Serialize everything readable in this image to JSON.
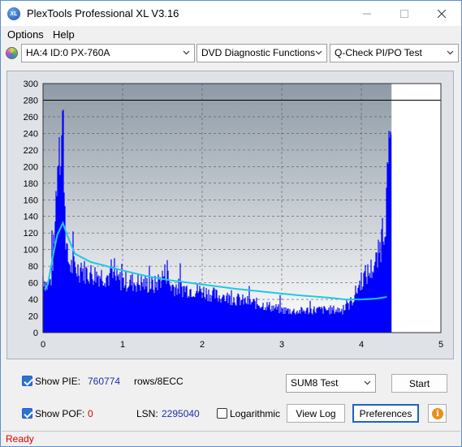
{
  "window": {
    "title": "PlexTools Professional XL V3.16",
    "app_icon_text": "XL"
  },
  "menu": {
    "options": "Options",
    "help": "Help"
  },
  "toolbar": {
    "drive": "HA:4 ID:0  PX-760A",
    "function": "DVD Diagnostic Functions",
    "test": "Q-Check PI/PO Test"
  },
  "chart_data": {
    "type": "bar",
    "x_ticks": [
      "0",
      "1",
      "2",
      "3",
      "4",
      "5"
    ],
    "y_ticks": [
      "0",
      "20",
      "40",
      "60",
      "80",
      "100",
      "120",
      "140",
      "160",
      "180",
      "200",
      "220",
      "240",
      "260",
      "280",
      "300"
    ],
    "xlim": [
      0,
      5
    ],
    "ylim": [
      0,
      300
    ],
    "limit_line": 280,
    "grid": true,
    "data_end": 4.38,
    "series": [
      {
        "kind": "bars",
        "color": "#0000ff",
        "x": [
          0.0,
          0.05,
          0.1,
          0.15,
          0.18,
          0.2,
          0.22,
          0.25,
          0.28,
          0.3,
          0.35,
          0.4,
          0.5,
          0.6,
          0.8,
          1.0,
          1.2,
          1.4,
          1.55,
          1.6,
          1.8,
          2.0,
          2.2,
          2.4,
          2.6,
          2.8,
          3.0,
          3.2,
          3.4,
          3.6,
          3.8,
          3.9,
          4.0,
          4.1,
          4.2,
          4.25,
          4.3,
          4.33,
          4.36,
          4.38
        ],
        "y": [
          75,
          62,
          70,
          130,
          200,
          285,
          240,
          290,
          150,
          100,
          88,
          85,
          82,
          78,
          75,
          68,
          66,
          62,
          80,
          62,
          58,
          55,
          48,
          45,
          40,
          36,
          30,
          28,
          30,
          30,
          30,
          45,
          70,
          80,
          95,
          120,
          150,
          200,
          240,
          300
        ]
      },
      {
        "kind": "line",
        "color": "#1ec8e8",
        "x": [
          0.02,
          0.06,
          0.12,
          0.18,
          0.25,
          0.3,
          0.4,
          0.6,
          0.8,
          1.0,
          1.3,
          1.6,
          2.0,
          2.4,
          2.8,
          3.2,
          3.6,
          3.8,
          4.0,
          4.2,
          4.32
        ],
        "y": [
          52,
          58,
          90,
          118,
          132,
          118,
          95,
          85,
          80,
          75,
          68,
          63,
          58,
          53,
          49,
          45,
          42,
          40,
          40,
          41,
          43
        ]
      }
    ]
  },
  "bottom": {
    "show_pie_label": "Show PIE:",
    "pie_value": "760774",
    "rows_label": "rows/8ECC",
    "show_pof_label": "Show POF:",
    "pof_value": "0",
    "lsn_label": "LSN:",
    "lsn_value": "2295040",
    "logarithmic_label": "Logarithmic",
    "test_mode": "SUM8 Test",
    "start": "Start",
    "view_log": "View Log",
    "preferences": "Preferences"
  },
  "status": {
    "text": "Ready"
  }
}
